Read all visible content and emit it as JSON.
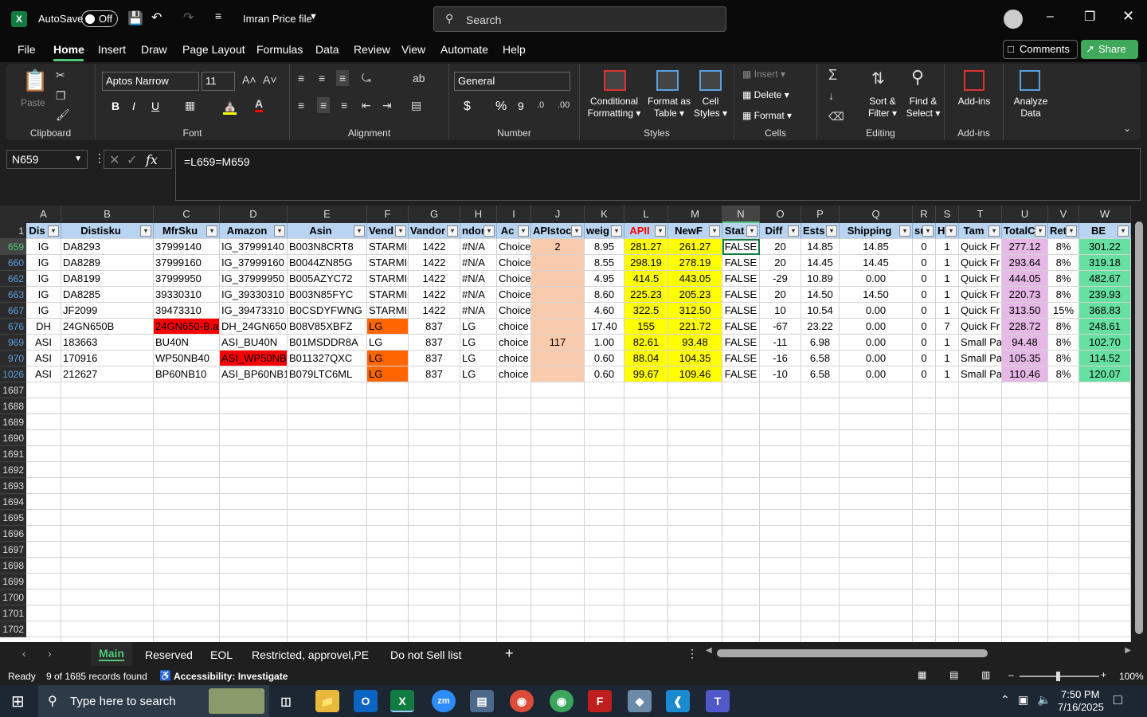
{
  "titlebar": {
    "autosave_label": "AutoSave",
    "autosave_state": "Off",
    "filename": "Imran Price file",
    "search_placeholder": "Search"
  },
  "ribbon_tabs": [
    "File",
    "Home",
    "Insert",
    "Draw",
    "Page Layout",
    "Formulas",
    "Data",
    "Review",
    "View",
    "Automate",
    "Help"
  ],
  "ribbon_right": {
    "comments": "Comments",
    "share": "Share"
  },
  "ribbon": {
    "paste": "Paste",
    "clipboard": "Clipboard",
    "font_name": "Aptos Narrow",
    "font_size": "11",
    "bold": "B",
    "italic": "I",
    "underline": "U",
    "font": "Font",
    "alignment": "Alignment",
    "number_format": "General",
    "number": "Number",
    "currency": "$",
    "percent": "%",
    "comma": "9",
    "cond_format_1": "Conditional",
    "cond_format_2": "Formatting",
    "format_table_1": "Format as",
    "format_table_2": "Table",
    "cell_styles_1": "Cell",
    "cell_styles_2": "Styles",
    "styles": "Styles",
    "insert": "Insert",
    "delete": "Delete",
    "format": "Format",
    "cells": "Cells",
    "sort_1": "Sort &",
    "sort_2": "Filter",
    "find_1": "Find &",
    "find_2": "Select",
    "editing": "Editing",
    "addins": "Add-ins",
    "analyze_1": "Analyze",
    "analyze_2": "Data",
    "addins_group": "Add-ins"
  },
  "formula_bar": {
    "name_box": "N659",
    "fx": "fx",
    "formula": "=L659=M659"
  },
  "columns": [
    "A",
    "B",
    "C",
    "D",
    "E",
    "F",
    "G",
    "H",
    "I",
    "J",
    "K",
    "L",
    "M",
    "N",
    "O",
    "P",
    "Q",
    "R",
    "S",
    "T",
    "U",
    "V",
    "W"
  ],
  "headers": [
    "Dis",
    "Distisku",
    "MfrSku",
    "Amazon",
    "Asin",
    "Vend",
    "Vandor",
    "ndor",
    "Ac",
    "APIstoc",
    "weig",
    "APII",
    "NewF",
    "Stat",
    "Diff",
    "Ests",
    "Shipping",
    "su",
    "H",
    "Tam",
    "TotalC",
    "Ret",
    "BE"
  ],
  "rows": [
    {
      "n": "659",
      "c": [
        "IG",
        "DA8293",
        "37999140",
        "IG_37999140",
        "B003N8CRT8",
        "STARMIC",
        "1422",
        "#N/A",
        "Choice",
        "2",
        "8.95",
        "281.27",
        "261.27",
        "FALSE",
        "20",
        "14.85",
        "14.85",
        "0",
        "1",
        "Quick Fr",
        "277.12",
        "8%",
        "301.22"
      ]
    },
    {
      "n": "660",
      "c": [
        "IG",
        "DA8289",
        "37999160",
        "IG_37999160",
        "B0044ZN85G",
        "STARMIC",
        "1422",
        "#N/A",
        "Choice",
        "",
        "8.55",
        "298.19",
        "278.19",
        "FALSE",
        "20",
        "14.45",
        "14.45",
        "0",
        "1",
        "Quick Fr",
        "293.64",
        "8%",
        "319.18"
      ]
    },
    {
      "n": "662",
      "c": [
        "IG",
        "DA8199",
        "37999950",
        "IG_37999950",
        "B005AZYC72",
        "STARMIC",
        "1422",
        "#N/A",
        "Choice",
        "",
        "4.95",
        "414.5",
        "443.05",
        "FALSE",
        "-29",
        "10.89",
        "0.00",
        "0",
        "1",
        "Quick Fr",
        "444.05",
        "8%",
        "482.67"
      ]
    },
    {
      "n": "663",
      "c": [
        "IG",
        "DA8285",
        "39330310",
        "IG_39330310",
        "B003N85FYC",
        "STARMIC",
        "1422",
        "#N/A",
        "Choice",
        "",
        "8.60",
        "225.23",
        "205.23",
        "FALSE",
        "20",
        "14.50",
        "14.50",
        "0",
        "1",
        "Quick Fr",
        "220.73",
        "8%",
        "239.93"
      ]
    },
    {
      "n": "667",
      "c": [
        "IG",
        "JF2099",
        "39473310",
        "IG_39473310",
        "B0CSDYFWNG",
        "STARMIC",
        "1422",
        "#N/A",
        "Choice",
        "",
        "4.60",
        "322.5",
        "312.50",
        "FALSE",
        "10",
        "10.54",
        "0.00",
        "0",
        "1",
        "Quick Fr",
        "313.50",
        "15%",
        "368.83"
      ]
    },
    {
      "n": "676",
      "c": [
        "DH",
        "24GN650B",
        "24GN650-B.a",
        "DH_24GN650-",
        "B08V85XBFZ",
        "LG",
        "837",
        "LG",
        "choice",
        "",
        "17.40",
        "155",
        "221.72",
        "FALSE",
        "-67",
        "23.22",
        "0.00",
        "0",
        "7",
        "Quick Fr",
        "228.72",
        "8%",
        "248.61"
      ]
    },
    {
      "n": "969",
      "c": [
        "ASI",
        "183663",
        "BU40N",
        "ASI_BU40N",
        "B01MSDDR8A",
        "LG",
        "837",
        "LG",
        "choice",
        "117",
        "1.00",
        "82.61",
        "93.48",
        "FALSE",
        "-11",
        "6.98",
        "0.00",
        "0",
        "1",
        "Small Pa",
        "94.48",
        "8%",
        "102.70"
      ]
    },
    {
      "n": "970",
      "c": [
        "ASI",
        "170916",
        "WP50NB40",
        "ASI_WP50NB4",
        "B011327QXC",
        "LG",
        "837",
        "LG",
        "choice",
        "",
        "0.60",
        "88.04",
        "104.35",
        "FALSE",
        "-16",
        "6.58",
        "0.00",
        "0",
        "1",
        "Small Pa",
        "105.35",
        "8%",
        "114.52"
      ]
    },
    {
      "n": "1026",
      "c": [
        "ASI",
        "212627",
        "BP60NB10",
        "ASI_BP60NB10",
        "B079LTC6ML",
        "LG",
        "837",
        "LG",
        "choice",
        "",
        "0.60",
        "99.67",
        "109.46",
        "FALSE",
        "-10",
        "6.58",
        "0.00",
        "0",
        "1",
        "Small Pa",
        "110.46",
        "8%",
        "120.07"
      ]
    }
  ],
  "empty_rows": [
    "1687",
    "1688",
    "1689",
    "1690",
    "1691",
    "1692",
    "1693",
    "1694",
    "1695",
    "1696",
    "1697",
    "1698",
    "1699",
    "1700",
    "1701",
    "1702"
  ],
  "sheet_tabs": [
    "Main",
    "Reserved",
    "EOL",
    "Restricted, approvel,PE",
    "Do not Sell list"
  ],
  "status": {
    "ready": "Ready",
    "records": "9 of 1685 records found",
    "accessibility": "Accessibility: Investigate",
    "zoom": "100%"
  },
  "taskbar": {
    "search_placeholder": "Type here to search",
    "time": "7:50 PM",
    "date": "7/16/2025"
  },
  "colors": {
    "excel_green": "#107c41",
    "yellow": "#ffff00",
    "peach": "#f8cbad",
    "red": "#ff0000",
    "orange": "#ff6600",
    "pink": "#e6b8e6",
    "green": "#66e0a0",
    "header_blue": "#b8d4f0"
  }
}
